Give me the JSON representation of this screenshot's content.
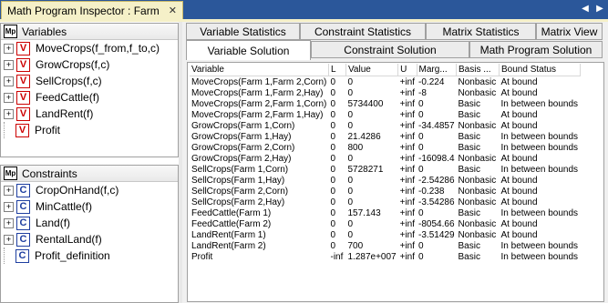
{
  "window": {
    "title": "Math Program Inspector : Farm"
  },
  "variables_panel": {
    "header": "Variables",
    "items": [
      {
        "label": "MoveCrops(f_from,f_to,c)",
        "expandable": true
      },
      {
        "label": "GrowCrops(f,c)",
        "expandable": true
      },
      {
        "label": "SellCrops(f,c)",
        "expandable": true
      },
      {
        "label": "FeedCattle(f)",
        "expandable": true
      },
      {
        "label": "LandRent(f)",
        "expandable": true
      },
      {
        "label": "Profit",
        "expandable": false
      }
    ]
  },
  "constraints_panel": {
    "header": "Constraints",
    "items": [
      {
        "label": "CropOnHand(f,c)",
        "expandable": true
      },
      {
        "label": "MinCattle(f)",
        "expandable": true
      },
      {
        "label": "Land(f)",
        "expandable": true
      },
      {
        "label": "RentalLand(f)",
        "expandable": true
      },
      {
        "label": "Profit_definition",
        "expandable": false
      }
    ]
  },
  "tabs_top": [
    "Variable Statistics",
    "Constraint Statistics",
    "Matrix Statistics",
    "Matrix View"
  ],
  "tabs_bottom": [
    "Variable Solution",
    "Constraint Solution",
    "Math Program Solution"
  ],
  "active_tab": "Variable Solution",
  "table": {
    "columns": [
      "Variable",
      "L",
      "Value",
      "U",
      "Marg...",
      "Basis ...",
      "Bound Status"
    ],
    "rows": [
      [
        "MoveCrops(Farm 1,Farm 2,Corn)",
        "0",
        "0",
        "+inf",
        "-0.224",
        "Nonbasic",
        "At bound"
      ],
      [
        "MoveCrops(Farm 1,Farm 2,Hay)",
        "0",
        "0",
        "+inf",
        "-8",
        "Nonbasic",
        "At bound"
      ],
      [
        "MoveCrops(Farm 2,Farm 1,Corn)",
        "0",
        "5734400",
        "+inf",
        "0",
        "Basic",
        "In between bounds"
      ],
      [
        "MoveCrops(Farm 2,Farm 1,Hay)",
        "0",
        "0",
        "+inf",
        "0",
        "Basic",
        "At bound"
      ],
      [
        "GrowCrops(Farm 1,Corn)",
        "0",
        "0",
        "+inf",
        "-34.4857",
        "Nonbasic",
        "At bound"
      ],
      [
        "GrowCrops(Farm 1,Hay)",
        "0",
        "21.4286",
        "+inf",
        "0",
        "Basic",
        "In between bounds"
      ],
      [
        "GrowCrops(Farm 2,Corn)",
        "0",
        "800",
        "+inf",
        "0",
        "Basic",
        "In between bounds"
      ],
      [
        "GrowCrops(Farm 2,Hay)",
        "0",
        "0",
        "+inf",
        "-16098.4",
        "Nonbasic",
        "At bound"
      ],
      [
        "SellCrops(Farm 1,Corn)",
        "0",
        "5728271",
        "+inf",
        "0",
        "Basic",
        "In between bounds"
      ],
      [
        "SellCrops(Farm 1,Hay)",
        "0",
        "0",
        "+inf",
        "-2.54286",
        "Nonbasic",
        "At bound"
      ],
      [
        "SellCrops(Farm 2,Corn)",
        "0",
        "0",
        "+inf",
        "-0.238",
        "Nonbasic",
        "At bound"
      ],
      [
        "SellCrops(Farm 2,Hay)",
        "0",
        "0",
        "+inf",
        "-3.54286",
        "Nonbasic",
        "At bound"
      ],
      [
        "FeedCattle(Farm 1)",
        "0",
        "157.143",
        "+inf",
        "0",
        "Basic",
        "In between bounds"
      ],
      [
        "FeedCattle(Farm 2)",
        "0",
        "0",
        "+inf",
        "-8054.66",
        "Nonbasic",
        "At bound"
      ],
      [
        "LandRent(Farm 1)",
        "0",
        "0",
        "+inf",
        "-3.51429",
        "Nonbasic",
        "At bound"
      ],
      [
        "LandRent(Farm 2)",
        "0",
        "700",
        "+inf",
        "0",
        "Basic",
        "In between bounds"
      ],
      [
        "Profit",
        "-inf",
        "1.287e+007",
        "+inf",
        "0",
        "Basic",
        "In between bounds"
      ]
    ]
  },
  "colors": {
    "titlebar": "#2b579a",
    "doc_tab": "#f5f0c8",
    "variable_icon": "#cc0000",
    "constraint_icon": "#1e3ea0"
  }
}
